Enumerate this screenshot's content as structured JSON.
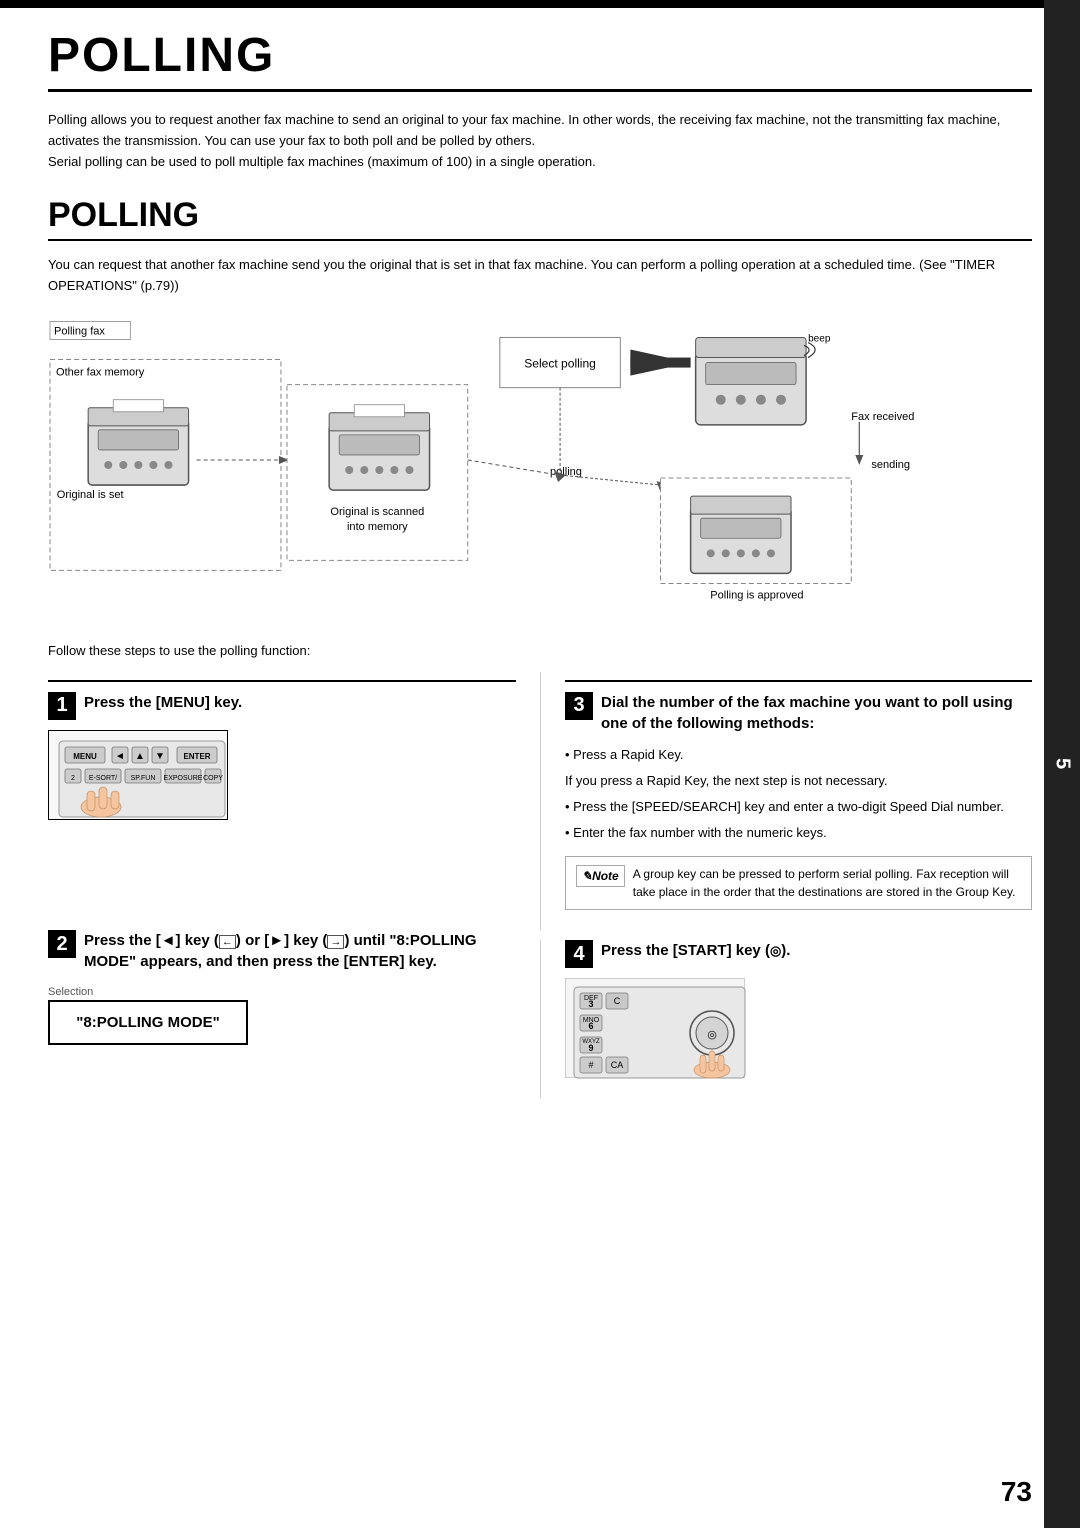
{
  "page": {
    "main_title": "POLLING",
    "top_border": true,
    "intro_paragraphs": [
      "Polling allows you to request another fax machine to send an original to your fax machine. In other words, the receiving fax machine, not the transmitting fax machine, activates the transmission. You can use your fax to both poll and be polled by others.",
      "Serial polling can be used to poll multiple fax machines (maximum of 100) in a single operation."
    ],
    "section_title": "POLLING",
    "section_desc": "You can request that another fax machine send you the original that is set in that fax machine. You can perform a polling operation at a scheduled time. (See \"TIMER OPERATIONS\" (p.79))",
    "diagram": {
      "polling_fax_label": "Polling fax",
      "other_fax_memory_label": "Other fax memory",
      "select_polling_label": "Select polling",
      "polling_label": "polling",
      "memory_label": "memory",
      "original_is_set_label": "Original is set",
      "original_is_scanned_label": "Original is scanned\ninto memory",
      "polling_is_approved_label": "Polling is approved",
      "beep_label": "beep",
      "fax_received_label": "Fax received",
      "sending_label": "sending"
    },
    "follow_text": "Follow these steps to use the polling function:",
    "steps": [
      {
        "number": "1",
        "title": "Press the [MENU] key."
      },
      {
        "number": "2",
        "title": "Press the [◄] key (     ) or [►] key (     ) until \"8:POLLING MODE\" appears, and then press the [ENTER] key."
      },
      {
        "number": "3",
        "title": "Dial the number of the fax machine you want to poll using one of the following methods:"
      },
      {
        "number": "4",
        "title": "Press the  [START] key (   )."
      }
    ],
    "selection_label": "Selection",
    "polling_mode_text": "\"8:POLLING MODE\"",
    "step3_bullets": [
      "• Press a Rapid Key.",
      "If you press a Rapid Key, the next step is not necessary.",
      "• Press the [SPEED/SEARCH] key and enter a two-digit Speed Dial number.",
      "• Enter the fax number with the numeric keys."
    ],
    "note_text": "A group key can be pressed to perform serial polling. Fax reception will take place in the order that the destinations are stored in the Group Key.",
    "page_number": "73",
    "chapter_number": "5"
  }
}
